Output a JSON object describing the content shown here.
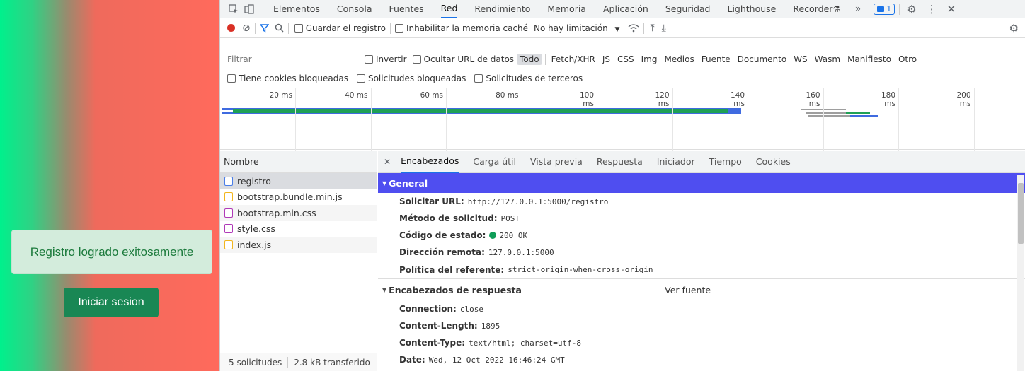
{
  "page": {
    "alert_text": "Registro logrado exitosamente",
    "login_button": "Iniciar sesion"
  },
  "devtools": {
    "tabs": [
      "Elementos",
      "Consola",
      "Fuentes",
      "Red",
      "Rendimiento",
      "Memoria",
      "Aplicación",
      "Seguridad",
      "Lighthouse",
      "Recorder"
    ],
    "active_tab": "Red",
    "more_tabs": "»",
    "issues_count": "1",
    "network_toolbar": {
      "preserve_log": "Guardar el registro",
      "disable_cache": "Inhabilitar la memoria caché",
      "throttling": "No hay limitación"
    },
    "filter": {
      "placeholder": "Filtrar",
      "invert": "Invertir",
      "hide_data_urls": "Ocultar URL de datos",
      "types": [
        "Todo",
        "Fetch/XHR",
        "JS",
        "CSS",
        "Img",
        "Medios",
        "Fuente",
        "Documento",
        "WS",
        "Wasm",
        "Manifiesto",
        "Otro"
      ],
      "active_type": "Todo"
    },
    "cookie_filters": [
      "Tiene cookies bloqueadas",
      "Solicitudes bloqueadas",
      "Solicitudes de terceros"
    ],
    "timeline_ticks": [
      "20 ms",
      "40 ms",
      "60 ms",
      "80 ms",
      "100 ms",
      "120 ms",
      "140 ms",
      "160 ms",
      "180 ms",
      "200 ms"
    ],
    "names_header": "Nombre",
    "files": [
      {
        "name": "registro",
        "type": "doc"
      },
      {
        "name": "bootstrap.bundle.min.js",
        "type": "js"
      },
      {
        "name": "bootstrap.min.css",
        "type": "css"
      },
      {
        "name": "style.css",
        "type": "css"
      },
      {
        "name": "index.js",
        "type": "js"
      }
    ],
    "footer": {
      "requests": "5 solicitudes",
      "transferred": "2.8 kB transferido"
    },
    "detail_tabs": [
      "Encabezados",
      "Carga útil",
      "Vista previa",
      "Respuesta",
      "Iniciador",
      "Tiempo",
      "Cookies"
    ],
    "active_detail_tab": "Encabezados",
    "general": {
      "title": "General",
      "request_url_k": "Solicitar URL:",
      "request_url_v": "http://127.0.0.1:5000/registro",
      "method_k": "Método de solicitud:",
      "method_v": "POST",
      "status_k": "Código de estado:",
      "status_v": "200 OK",
      "remote_k": "Dirección remota:",
      "remote_v": "127.0.0.1:5000",
      "referrer_k": "Política del referente:",
      "referrer_v": "strict-origin-when-cross-origin"
    },
    "response_headers": {
      "title": "Encabezados de respuesta",
      "view_source": "Ver fuente",
      "connection_k": "Connection:",
      "connection_v": "close",
      "length_k": "Content-Length:",
      "length_v": "1895",
      "type_k": "Content-Type:",
      "type_v": "text/html; charset=utf-8",
      "date_k": "Date:",
      "date_v": "Wed, 12 Oct 2022 16:46:24 GMT"
    },
    "colors": {
      "accent": "#1a73e8",
      "general_bg": "#4f4ef0",
      "record": "#d93025",
      "success": "#198754"
    }
  }
}
